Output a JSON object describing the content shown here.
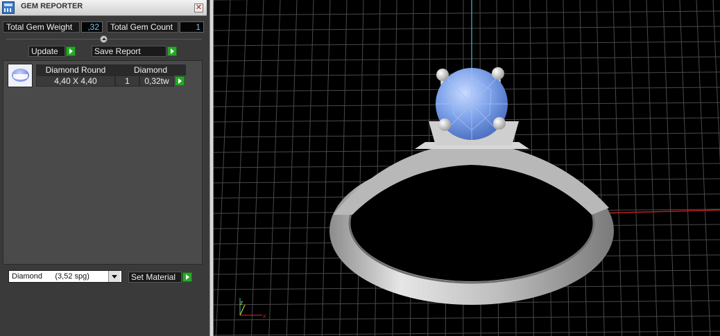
{
  "window": {
    "title": "GEM REPORTER"
  },
  "summary": {
    "weight_label": "Total Gem Weight",
    "weight_value": ",32",
    "count_label": "Total Gem Count",
    "count_value": "1"
  },
  "actions": {
    "update_label": "Update",
    "save_report_label": "Save Report"
  },
  "gem_table": {
    "headers": [
      "Diamond Round",
      "Diamond"
    ],
    "rows": [
      {
        "size": "4,40 X 4,40",
        "count": "1",
        "weight": "0,32tw"
      }
    ]
  },
  "material": {
    "selected": "Diamond      (3,52 spg)",
    "set_label": "Set Material"
  },
  "viewport": {
    "axis_colors": {
      "x": "#c0211b",
      "y": "#2aa0a8",
      "z": "#d8c21a"
    },
    "gem_color": "#7ea3ea",
    "metal_color": "#c9c9c9"
  },
  "icons": {
    "app": "gem-reporter-app-icon",
    "close": "close-icon",
    "collapse": "collapse-up-icon",
    "go": "green-arrow-icon",
    "dropdown": "chevron-down-icon",
    "thumbnail": "round-diamond-thumbnail"
  }
}
